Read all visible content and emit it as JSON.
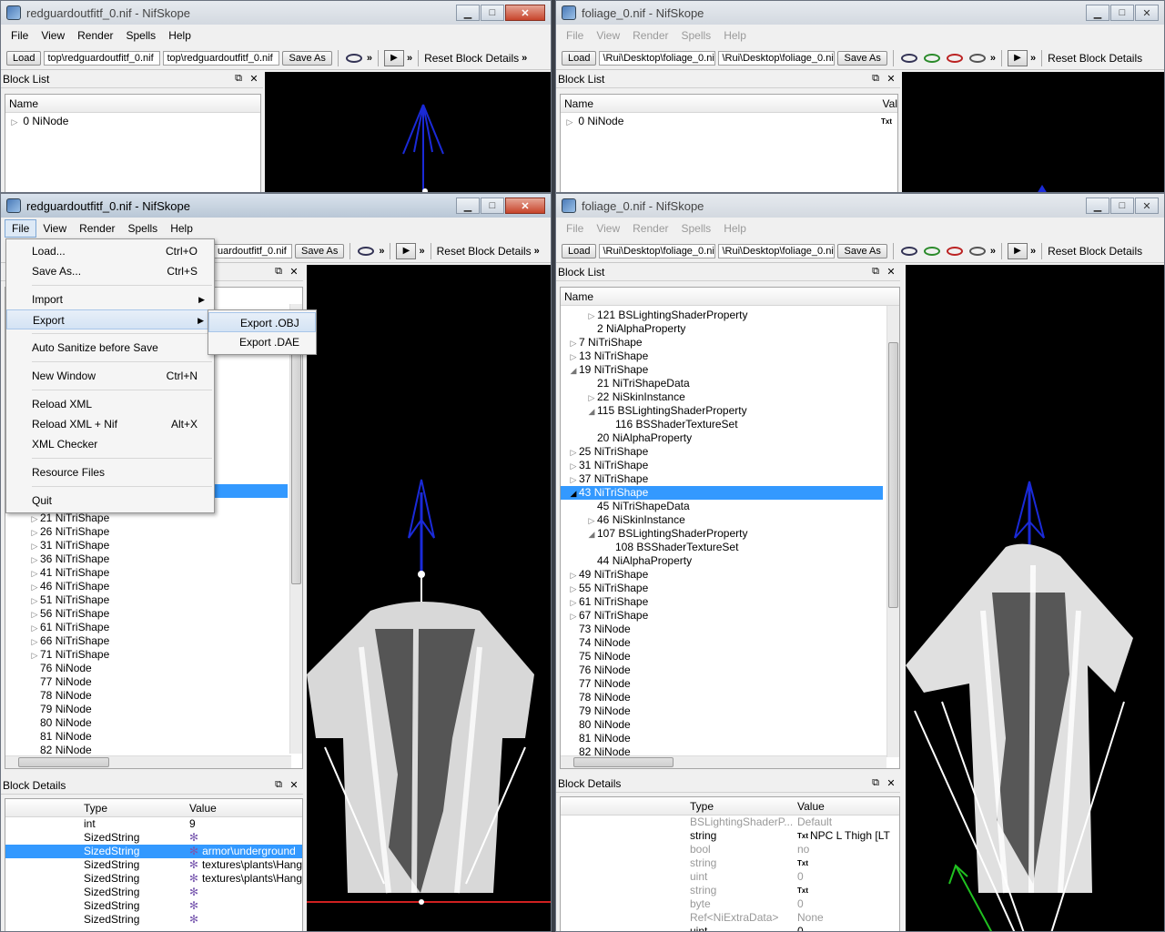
{
  "common": {
    "menu": [
      "File",
      "View",
      "Render",
      "Spells",
      "Help"
    ],
    "load_label": "Load",
    "save_as_label": "Save As",
    "reset_label": "Reset Block Details",
    "block_list_title": "Block List",
    "block_details_title": "Block Details",
    "name_col": "Name",
    "type_col": "Type",
    "value_col": "Value",
    "val_col_short": "Val",
    "overflow": "»"
  },
  "win_tl": {
    "title": "redguardoutfitf_0.nif - NifSkope",
    "load_path": "top\\redguardoutfitf_0.nif",
    "save_path": "top\\redguardoutfitf_0.nif",
    "rows": [
      {
        "num": "0",
        "name": "NiNode"
      }
    ]
  },
  "win_tr": {
    "title": "foliage_0.nif - NifSkope",
    "load_path": "\\Rui\\Desktop\\foliage_0.nif",
    "save_path": "\\Rui\\Desktop\\foliage_0.nif",
    "rows": [
      {
        "num": "0",
        "name": "NiNode",
        "val": "Txt"
      }
    ]
  },
  "win_bl": {
    "title": "redguardoutfitf_0.nif - NifSkope",
    "save_path": "uardoutfitf_0.nif",
    "file_menu": [
      {
        "label": "Load...",
        "shortcut": "Ctrl+O"
      },
      {
        "label": "Save As...",
        "shortcut": "Ctrl+S"
      },
      {
        "sep": true
      },
      {
        "label": "Import",
        "sub": true
      },
      {
        "label": "Export",
        "sub": true,
        "hl": true
      },
      {
        "sep": true
      },
      {
        "label": "Auto Sanitize before Save"
      },
      {
        "sep": true
      },
      {
        "label": "New Window",
        "shortcut": "Ctrl+N"
      },
      {
        "sep": true
      },
      {
        "label": "Reload XML"
      },
      {
        "label": "Reload XML + Nif",
        "shortcut": "Alt+X"
      },
      {
        "label": "XML Checker"
      },
      {
        "sep": true
      },
      {
        "label": "Resource Files"
      },
      {
        "sep": true
      },
      {
        "label": "Quit"
      }
    ],
    "export_submenu": [
      "Export .OBJ",
      "Export .DAE"
    ],
    "rows": [
      {
        "num": "21",
        "name": "NiTriShape",
        "exp": true
      },
      {
        "num": "26",
        "name": "NiTriShape",
        "exp": true
      },
      {
        "num": "31",
        "name": "NiTriShape",
        "exp": true
      },
      {
        "num": "36",
        "name": "NiTriShape",
        "exp": true
      },
      {
        "num": "41",
        "name": "NiTriShape",
        "exp": true
      },
      {
        "num": "46",
        "name": "NiTriShape",
        "exp": true
      },
      {
        "num": "51",
        "name": "NiTriShape",
        "exp": true
      },
      {
        "num": "56",
        "name": "NiTriShape",
        "exp": true
      },
      {
        "num": "61",
        "name": "NiTriShape",
        "exp": true
      },
      {
        "num": "66",
        "name": "NiTriShape",
        "exp": true
      },
      {
        "num": "71",
        "name": "NiTriShape",
        "exp": true
      },
      {
        "num": "76",
        "name": "NiNode"
      },
      {
        "num": "77",
        "name": "NiNode"
      },
      {
        "num": "78",
        "name": "NiNode"
      },
      {
        "num": "79",
        "name": "NiNode"
      },
      {
        "num": "80",
        "name": "NiNode"
      },
      {
        "num": "81",
        "name": "NiNode"
      },
      {
        "num": "82",
        "name": "NiNode"
      }
    ],
    "details": [
      {
        "type": "int",
        "value": "9"
      },
      {
        "type": "SizedString",
        "value": "",
        "icon": true
      },
      {
        "type": "SizedString",
        "value": "armor\\underground",
        "icon": true,
        "sel": true
      },
      {
        "type": "SizedString",
        "value": "textures\\plants\\Hang",
        "icon": true
      },
      {
        "type": "SizedString",
        "value": "textures\\plants\\Hang",
        "icon": true
      },
      {
        "type": "SizedString",
        "value": "",
        "icon": true
      },
      {
        "type": "SizedString",
        "value": "",
        "icon": true
      },
      {
        "type": "SizedString",
        "value": "",
        "icon": true
      }
    ]
  },
  "win_br": {
    "title": "foliage_0.nif - NifSkope",
    "load_path": "\\Rui\\Desktop\\foliage_0.nif",
    "save_path": "\\Rui\\Desktop\\foliage_0.nif",
    "rows": [
      {
        "num": "121",
        "name": "BSLightingShaderProperty",
        "lvl": 2,
        "exp": "closed"
      },
      {
        "num": "2",
        "name": "NiAlphaProperty",
        "lvl": 2
      },
      {
        "num": "7",
        "name": "NiTriShape",
        "lvl": 1,
        "exp": "closed"
      },
      {
        "num": "13",
        "name": "NiTriShape",
        "lvl": 1,
        "exp": "closed"
      },
      {
        "num": "19",
        "name": "NiTriShape",
        "lvl": 1,
        "exp": "open"
      },
      {
        "num": "21",
        "name": "NiTriShapeData",
        "lvl": 2
      },
      {
        "num": "22",
        "name": "NiSkinInstance",
        "lvl": 2,
        "exp": "closed"
      },
      {
        "num": "115",
        "name": "BSLightingShaderProperty",
        "lvl": 2,
        "exp": "open"
      },
      {
        "num": "116",
        "name": "BSShaderTextureSet",
        "lvl": 3
      },
      {
        "num": "20",
        "name": "NiAlphaProperty",
        "lvl": 2
      },
      {
        "num": "25",
        "name": "NiTriShape",
        "lvl": 1,
        "exp": "closed"
      },
      {
        "num": "31",
        "name": "NiTriShape",
        "lvl": 1,
        "exp": "closed"
      },
      {
        "num": "37",
        "name": "NiTriShape",
        "lvl": 1,
        "exp": "closed"
      },
      {
        "num": "43",
        "name": "NiTriShape",
        "lvl": 1,
        "exp": "open",
        "sel": true
      },
      {
        "num": "45",
        "name": "NiTriShapeData",
        "lvl": 2
      },
      {
        "num": "46",
        "name": "NiSkinInstance",
        "lvl": 2,
        "exp": "closed"
      },
      {
        "num": "107",
        "name": "BSLightingShaderProperty",
        "lvl": 2,
        "exp": "open"
      },
      {
        "num": "108",
        "name": "BSShaderTextureSet",
        "lvl": 3
      },
      {
        "num": "44",
        "name": "NiAlphaProperty",
        "lvl": 2
      },
      {
        "num": "49",
        "name": "NiTriShape",
        "lvl": 1,
        "exp": "closed"
      },
      {
        "num": "55",
        "name": "NiTriShape",
        "lvl": 1,
        "exp": "closed"
      },
      {
        "num": "61",
        "name": "NiTriShape",
        "lvl": 1,
        "exp": "closed"
      },
      {
        "num": "67",
        "name": "NiTriShape",
        "lvl": 1,
        "exp": "closed"
      },
      {
        "num": "73",
        "name": "NiNode",
        "lvl": 1
      },
      {
        "num": "74",
        "name": "NiNode",
        "lvl": 1
      },
      {
        "num": "75",
        "name": "NiNode",
        "lvl": 1
      },
      {
        "num": "76",
        "name": "NiNode",
        "lvl": 1
      },
      {
        "num": "77",
        "name": "NiNode",
        "lvl": 1
      },
      {
        "num": "78",
        "name": "NiNode",
        "lvl": 1
      },
      {
        "num": "79",
        "name": "NiNode",
        "lvl": 1
      },
      {
        "num": "80",
        "name": "NiNode",
        "lvl": 1
      },
      {
        "num": "81",
        "name": "NiNode",
        "lvl": 1
      },
      {
        "num": "82",
        "name": "NiNode",
        "lvl": 1
      }
    ],
    "details": [
      {
        "type": "BSLightingShaderP...",
        "value": "Default",
        "grey": true
      },
      {
        "type": "string",
        "value": "NPC L Thigh [LT",
        "txt": true
      },
      {
        "type": "bool",
        "value": "no",
        "grey": true
      },
      {
        "type": "string",
        "value": "",
        "txt": true,
        "grey": true
      },
      {
        "type": "uint",
        "value": "0",
        "grey": true
      },
      {
        "type": "string",
        "value": "",
        "txt": true,
        "grey": true
      },
      {
        "type": "byte",
        "value": "0",
        "grey": true
      },
      {
        "type": "Ref<NiExtraData>",
        "value": "None",
        "grey": true
      },
      {
        "type": "uint",
        "value": "0"
      }
    ]
  }
}
